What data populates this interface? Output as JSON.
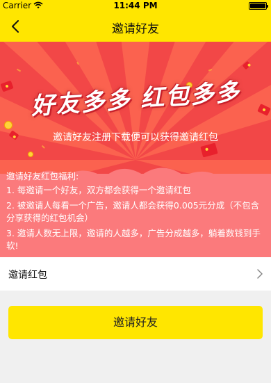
{
  "status_bar": {
    "carrier": "Carrier",
    "time": "11:44 PM"
  },
  "nav": {
    "title": "邀请好友"
  },
  "banner": {
    "headline": "好友多多 红包多多",
    "subtitle": "邀请好友注册下载便可以获得邀请红包"
  },
  "benefits": {
    "heading": "邀请好友红包福利:",
    "items": [
      "1. 每邀请一个好友，双方都会获得一个邀请红包",
      "2. 被邀请人每看一个广告，邀请人都会获得0.005元分成（不包含",
      "分享获得的红包机会）",
      "3. 邀请人数无上限，邀请的人越多，广告分成越多，躺着数钱到手",
      "软!"
    ]
  },
  "invite_row": {
    "label": "邀请红包"
  },
  "invite_button": {
    "label": "邀请好友"
  },
  "colors": {
    "brand_yellow": "#ffe600",
    "banner_red": "#f24747",
    "benefits_pink": "#fb7a7c",
    "page_bg": "#f0f0f0"
  },
  "icons": {
    "back": "chevron-left-icon",
    "row_arrow": "chevron-right-icon",
    "wifi": "wifi-icon",
    "battery": "battery-icon"
  }
}
